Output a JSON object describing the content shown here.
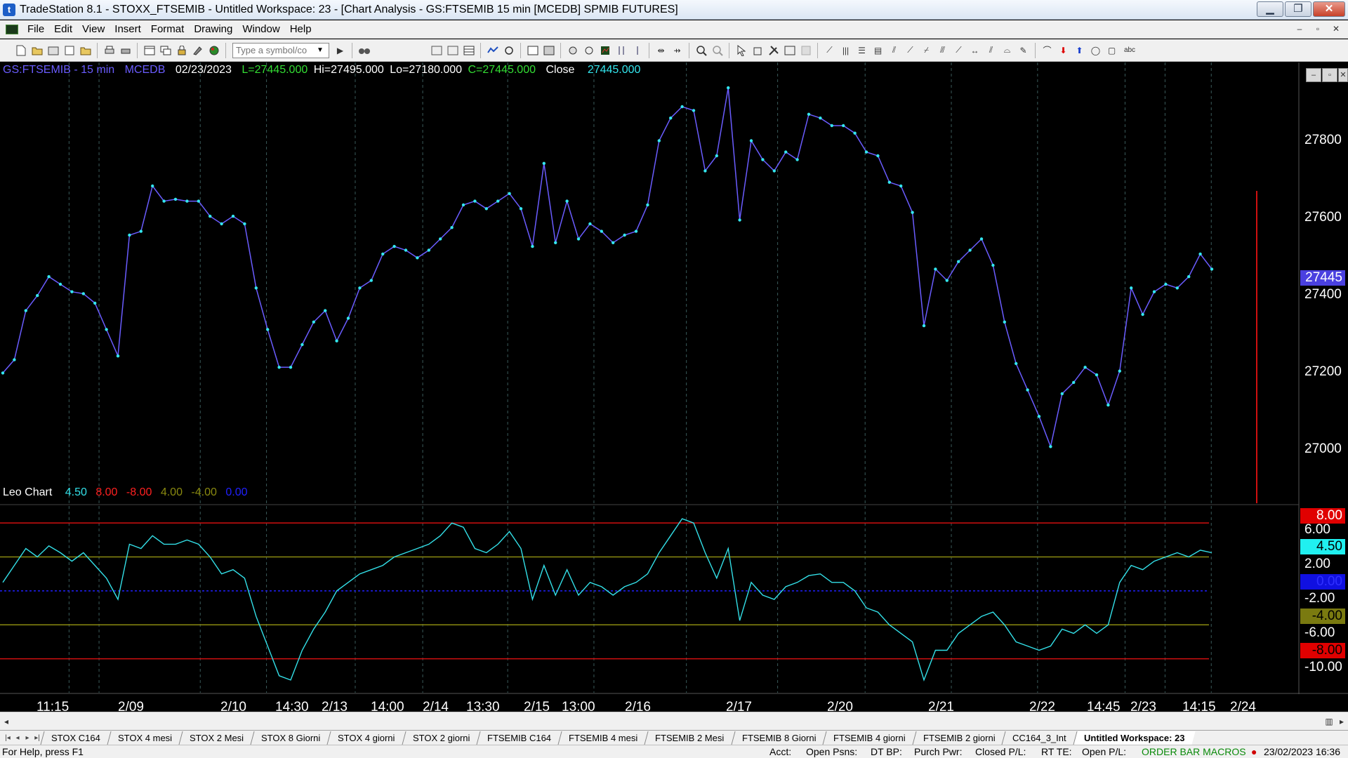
{
  "window": {
    "title": "TradeStation 8.1 - STOXX_FTSEMIB - Untitled Workspace:  23 - [Chart Analysis - GS:FTSEMIB  15 min  [MCEDB] SPMIB FUTURES]",
    "minimize": "▁",
    "restore": "❐",
    "close": "✕"
  },
  "menu": {
    "items": [
      "File",
      "Edit",
      "View",
      "Insert",
      "Format",
      "Drawing",
      "Window",
      "Help"
    ],
    "mdi_min": "–",
    "mdi_restore": "▫",
    "mdi_close": "✕"
  },
  "toolbar": {
    "symbol_placeholder": "Type a symbol/co",
    "icons_left": [
      "new-icon",
      "open-icon",
      "open-workspace-icon",
      "save-icon",
      "save-all-icon",
      "print-icon",
      "print-preview-icon",
      "window-icon",
      "cascade-icon",
      "lock-icon",
      "paint-icon",
      "globe-icon"
    ],
    "icons_right": [
      "chart-icon",
      "radar-icon",
      "matrix-icon",
      "scanner-icon",
      "gear-icon",
      "zoom-in-icon",
      "zoom-out-icon",
      "pointer-icon",
      "hand-icon",
      "text-icon",
      "abc-icon"
    ]
  },
  "chart_header": {
    "symbol": "GS:FTSEMIB - 15 min",
    "source": "MCEDB",
    "date": "02/23/2023",
    "last": "L=27445.000",
    "hi": "Hi=27495.000",
    "lo": "Lo=27180.000",
    "close_eq": "C=27445.000",
    "close_label": "Close",
    "close_value": "27445.000"
  },
  "indicator_header": {
    "name": "Leo Chart",
    "v1": "4.50",
    "v2": "8.00",
    "v3": "-8.00",
    "v4": "4.00",
    "v5": "-4.00",
    "v6": "0.00"
  },
  "colors": {
    "price_line": "#6a5cff",
    "price_dots": "#33e6ee",
    "indicator_line": "#33e0e8",
    "red_line": "#d01010",
    "olive_line": "#8a8a10",
    "blue_dash": "#2020ff",
    "axis_text": "#ffffff"
  },
  "price_axis": [
    "27800",
    "27600",
    "27400",
    "27200",
    "27000"
  ],
  "price_flag": "27445",
  "ind_axis": {
    "ticks": [
      "6.00",
      "2.00",
      "-2.00",
      "-6.00",
      "-10.00"
    ],
    "flag_8": "8.00",
    "flag_45": "4.50",
    "flag_0": "0.00",
    "flag_m4": "-4.00",
    "flag_m8": "-8.00"
  },
  "date_labels": [
    "11:15",
    "2/09",
    "2/10",
    "14:30",
    "2/13",
    "14:00",
    "2/14",
    "13:30",
    "2/15",
    "13:00",
    "2/16",
    "2/17",
    "2/20",
    "2/21",
    "2/22",
    "14:45",
    "2/23",
    "14:15",
    "2/24"
  ],
  "chart_data": [
    {
      "type": "line",
      "title": "GS:FTSEMIB - 15 min",
      "ylim": [
        26900,
        27950
      ],
      "x_ticks": [
        "11:15",
        "2/09",
        "2/10",
        "14:30",
        "2/13",
        "14:00",
        "2/14",
        "13:30",
        "2/15",
        "13:00",
        "2/16",
        "2/17",
        "2/20",
        "2/21",
        "2/22",
        "14:45",
        "2/23",
        "14:15",
        "2/24"
      ],
      "series": [
        {
          "values": [
            27165,
            27200,
            27330,
            27370,
            27420,
            27400,
            27380,
            27375,
            27350,
            27280,
            27210,
            27530,
            27540,
            27660,
            27620,
            27625,
            27620,
            27620,
            27580,
            27560,
            27580,
            27560,
            27390,
            27280,
            27180,
            27180,
            27240,
            27300,
            27330,
            27250,
            27310,
            27390,
            27410,
            27480,
            27500,
            27490,
            27470,
            27490,
            27520,
            27550,
            27610,
            27620,
            27600,
            27620,
            27640,
            27600,
            27500,
            27720,
            27510,
            27620,
            27520,
            27560,
            27540,
            27510,
            27530,
            27540,
            27610,
            27780,
            27840,
            27870,
            27860,
            27700,
            27740,
            27920,
            27570,
            27780,
            27730,
            27700,
            27750,
            27730,
            27850,
            27840,
            27820,
            27820,
            27800,
            27750,
            27740,
            27670,
            27660,
            27590,
            27290,
            27440,
            27410,
            27460,
            27490,
            27520,
            27450,
            27300,
            27190,
            27120,
            27050,
            26970,
            27110,
            27140,
            27180,
            27160,
            27080,
            27170,
            27390,
            27320,
            27380,
            27400,
            27390,
            27420,
            27480,
            27440
          ]
        }
      ]
    },
    {
      "type": "line",
      "title": "Leo Chart",
      "ylim": [
        -12,
        10
      ],
      "series": [
        {
          "name": "Leo Chart",
          "values": [
            1.0,
            3.0,
            5.0,
            4.0,
            5.3,
            4.5,
            3.5,
            4.5,
            3.0,
            1.5,
            -1.0,
            5.5,
            5.0,
            6.5,
            5.5,
            5.5,
            6.0,
            5.5,
            4.0,
            2.0,
            2.5,
            1.5,
            -3.0,
            -6.5,
            -10.0,
            -10.5,
            -7.0,
            -4.5,
            -2.5,
            0.0,
            1.0,
            2.0,
            2.5,
            3.0,
            4.0,
            4.5,
            5.0,
            5.5,
            6.5,
            8.0,
            7.5,
            5.0,
            4.5,
            5.5,
            7.0,
            5.0,
            -1.0,
            3.0,
            -0.5,
            2.5,
            -0.5,
            1.0,
            0.5,
            -0.5,
            0.5,
            1.0,
            2.0,
            4.5,
            6.5,
            8.5,
            8.0,
            4.5,
            1.5,
            5.0,
            -3.5,
            1.0,
            -0.5,
            -1.0,
            0.5,
            1.0,
            1.8,
            2.0,
            1.0,
            1.0,
            0.0,
            -2.0,
            -2.5,
            -4.0,
            -5.0,
            -6.0,
            -10.5,
            -7.0,
            -7.0,
            -5.0,
            -4.0,
            -3.0,
            -2.5,
            -4.0,
            -6.0,
            -6.5,
            -7.0,
            -6.5,
            -4.5,
            -5.0,
            -4.0,
            -5.0,
            -4.0,
            1.0,
            3.0,
            2.5,
            3.5,
            4.0,
            4.5,
            4.0,
            4.8,
            4.5
          ]
        }
      ],
      "levels": [
        8,
        4,
        0,
        -4,
        -8
      ]
    }
  ],
  "scrollbar": {
    "left": "◂",
    "right": "▸"
  },
  "tabs": {
    "nav": [
      "|◂",
      "◂",
      "▸",
      "▸|"
    ],
    "items": [
      "STOX C164",
      "STOX 4 mesi",
      "STOX  2 Mesi",
      "STOX  8 Giorni",
      "STOX 4 giorni",
      "STOX  2 giorni",
      "FTSEMIB C164",
      "FTSEMIB 4 mesi",
      "FTSEMIB  2 Mesi",
      "FTSEMIB  8 Giorni",
      "FTSEMIB  4 giorni",
      "FTSEMIB  2 giorni",
      "CC164_3_Int",
      "Untitled Workspace:  23"
    ]
  },
  "status": {
    "help": "For Help, press F1",
    "acct": "Acct:",
    "open_psns": "Open Psns:",
    "dt_bp": "DT BP:",
    "purch_pwr": "Purch Pwr:",
    "closed_pl": "Closed P/L:",
    "rt_te": "RT TE:",
    "open_pl": "Open P/L:",
    "macros": "ORDER BAR  MACROS",
    "datetime": "23/02/2023 16:36"
  }
}
